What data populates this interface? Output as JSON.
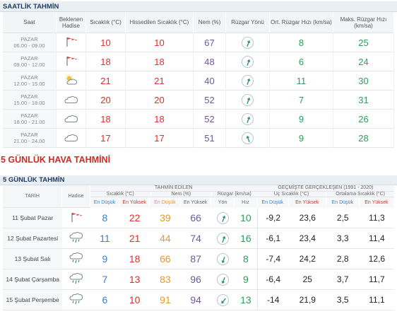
{
  "hourly": {
    "title": "SAATLİK TAHMİN",
    "headers": {
      "time": "Saat",
      "event": "Beklenen Hadise",
      "temp": "Sıcaklık (°C)",
      "feels": "Hissedilen Sıcaklık (°C)",
      "humidity": "Nem (%)",
      "wind_dir": "Rüzgar Yönü",
      "wind_avg": "Ort. Rüzgar Hızı (km/sa)",
      "wind_max": "Maks. Rüzgar Hızı (km/sa)"
    },
    "rows": [
      {
        "day": "PAZAR",
        "range": "06.00 - 09.00",
        "icon": "wind-flag-icon",
        "temp": "10",
        "feels": "10",
        "humidity": "67",
        "wind_deg": 20,
        "wind_avg": "8",
        "wind_max": "25"
      },
      {
        "day": "PAZAR",
        "range": "09.00 - 12.00",
        "icon": "wind-flag-icon",
        "temp": "18",
        "feels": "18",
        "humidity": "48",
        "wind_deg": 20,
        "wind_avg": "6",
        "wind_max": "24"
      },
      {
        "day": "PAZAR",
        "range": "12.00 - 15.00",
        "icon": "partly-cloudy-icon",
        "temp": "21",
        "feels": "21",
        "humidity": "40",
        "wind_deg": 20,
        "wind_avg": "11",
        "wind_max": "30"
      },
      {
        "day": "PAZAR",
        "range": "15.00 - 18.00",
        "icon": "cloud-icon",
        "temp": "20",
        "feels": "20",
        "humidity": "52",
        "wind_deg": 20,
        "wind_avg": "7",
        "wind_max": "31"
      },
      {
        "day": "PAZAR",
        "range": "18.00 - 21.00",
        "icon": "cloud-icon",
        "temp": "18",
        "feels": "18",
        "humidity": "52",
        "wind_deg": 20,
        "wind_avg": "9",
        "wind_max": "26"
      },
      {
        "day": "PAZAR",
        "range": "21.00 - 24.00",
        "icon": "cloud-icon",
        "temp": "17",
        "feels": "17",
        "humidity": "51",
        "wind_deg": 340,
        "wind_avg": "9",
        "wind_max": "28"
      }
    ]
  },
  "five_day_heading": "5 GÜNLÜK HAVA TAHMİNİ",
  "daily": {
    "title": "5 GÜNLÜK TAHMİN",
    "headers": {
      "date": "TARİH",
      "event": "Hadise",
      "forecast_group": "TAHMİN EDİLEN",
      "past_group": "GEÇMİŞTE GERÇEKLEŞEN (1991 - 2020)",
      "temp": "Sıcaklık (°C)",
      "humidity": "Nem (%)",
      "wind": "Rüzgar (km/sa)",
      "extreme": "Uç Sıcaklık (°C)",
      "average": "Ortalama Sıcaklık (°C)",
      "lowest": "En Düşük",
      "highest": "En Yüksek",
      "direction": "Yön",
      "speed": "Hız"
    },
    "rows": [
      {
        "date": "11 Şubat Pazar",
        "icon": "wind-flag-icon",
        "t_min": "8",
        "t_max": "22",
        "h_min": "39",
        "h_max": "66",
        "wind_deg": 20,
        "wind_speed": "10",
        "x_min": "-9,2",
        "x_max": "23,6",
        "a_min": "2,5",
        "a_max": "11,3"
      },
      {
        "date": "12 Şubat Pazartesi",
        "icon": "rain-cloud-icon",
        "t_min": "11",
        "t_max": "21",
        "h_min": "44",
        "h_max": "74",
        "wind_deg": 20,
        "wind_speed": "16",
        "x_min": "-6,1",
        "x_max": "23,4",
        "a_min": "3,3",
        "a_max": "11,4"
      },
      {
        "date": "13 Şubat Salı",
        "icon": "rain-cloud-icon",
        "t_min": "9",
        "t_max": "18",
        "h_min": "66",
        "h_max": "87",
        "wind_deg": 200,
        "wind_speed": "8",
        "x_min": "-7,4",
        "x_max": "24,2",
        "a_min": "2,8",
        "a_max": "12,6"
      },
      {
        "date": "14 Şubat Çarşamba",
        "icon": "rain-cloud-icon",
        "t_min": "7",
        "t_max": "13",
        "h_min": "83",
        "h_max": "96",
        "wind_deg": 200,
        "wind_speed": "9",
        "x_min": "-6,4",
        "x_max": "25",
        "a_min": "3,7",
        "a_max": "11,7"
      },
      {
        "date": "15 Şubat Perşembe",
        "icon": "rain-cloud-icon",
        "t_min": "6",
        "t_max": "10",
        "h_min": "91",
        "h_max": "94",
        "wind_deg": 220,
        "wind_speed": "13",
        "x_min": "-14",
        "x_max": "21,9",
        "a_min": "3,5",
        "a_max": "11,1"
      }
    ]
  }
}
